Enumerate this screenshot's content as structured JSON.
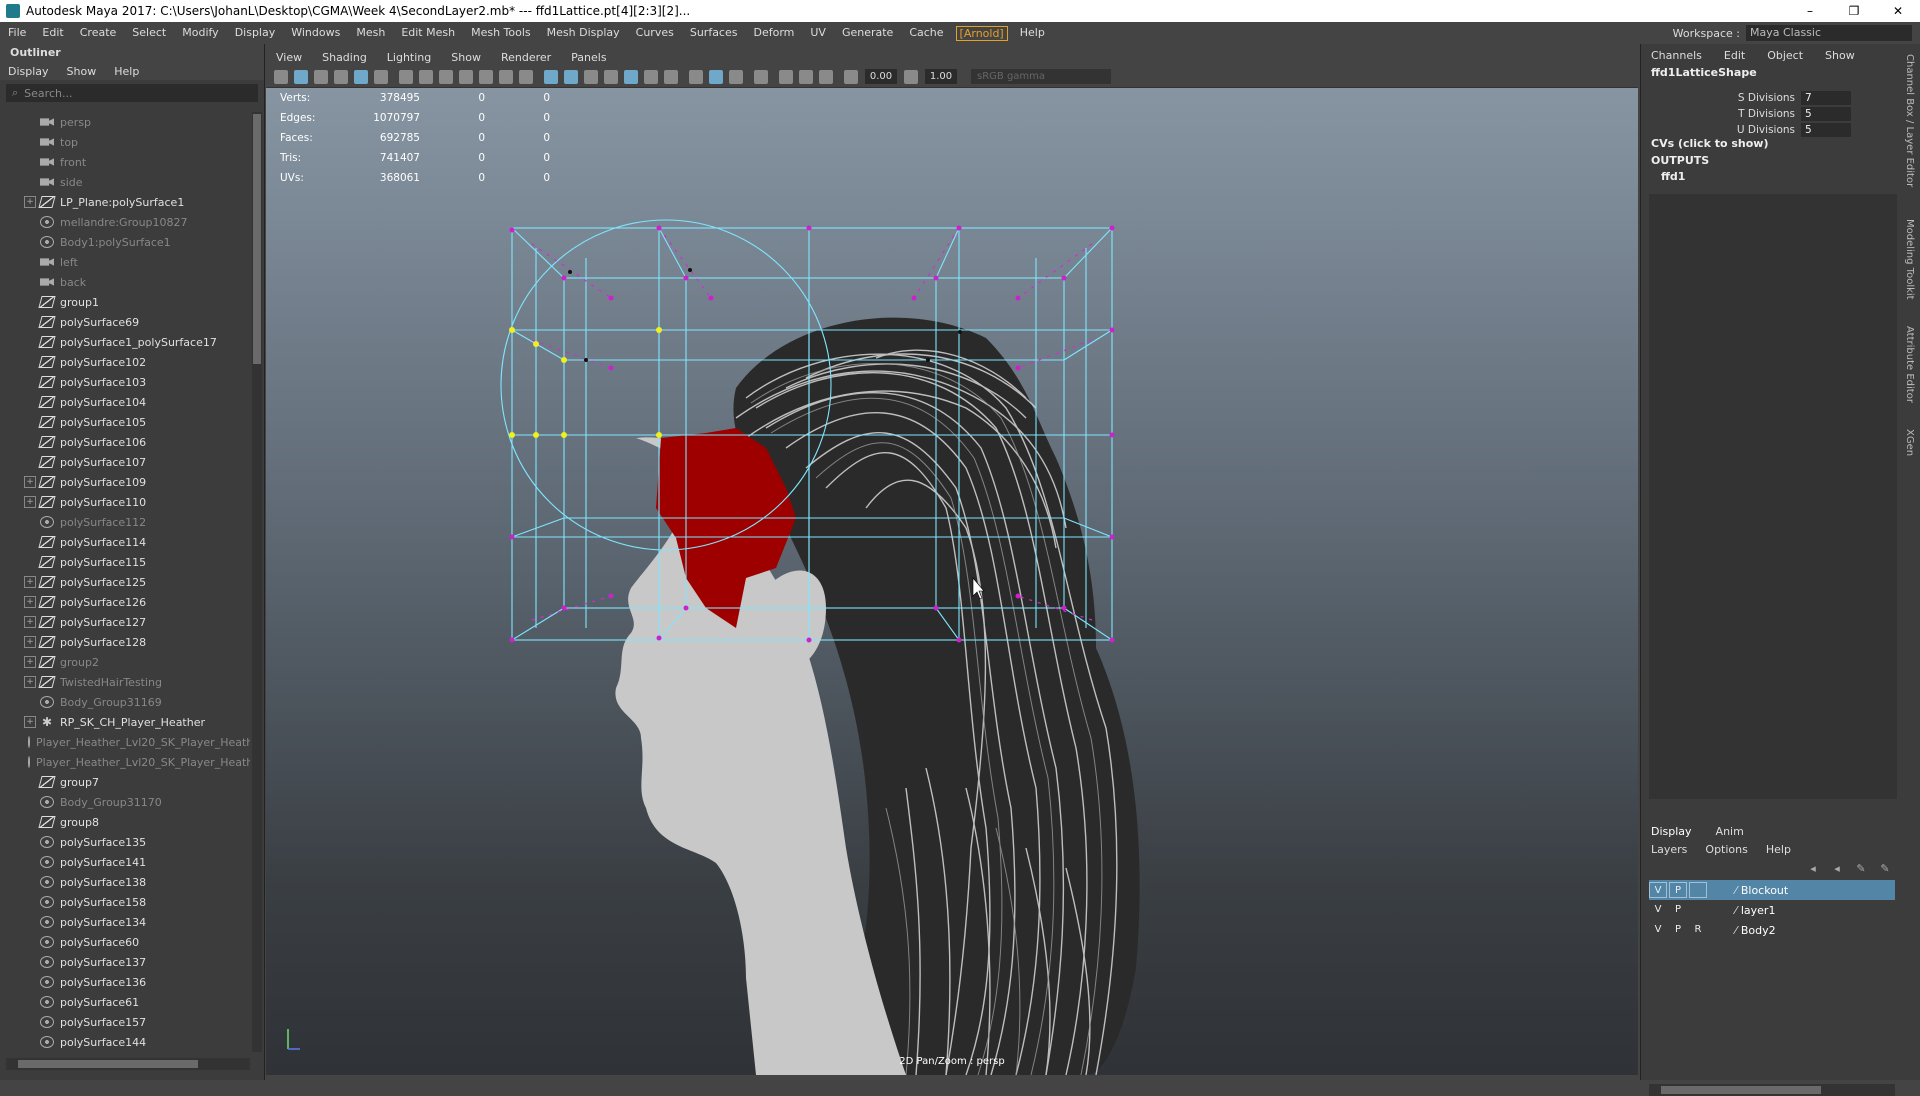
{
  "window": {
    "title": "Autodesk Maya 2017: C:\\Users\\JohanL\\Desktop\\CGMA\\Week 4\\SecondLayer2.mb*  ---  ffd1Lattice.pt[4][2:3][2]...",
    "minimize": "–",
    "maximize": "❐",
    "close": "✕"
  },
  "menubar": {
    "items": [
      "File",
      "Edit",
      "Create",
      "Select",
      "Modify",
      "Display",
      "Windows",
      "Mesh",
      "Edit Mesh",
      "Mesh Tools",
      "Mesh Display",
      "Curves",
      "Surfaces",
      "Deform",
      "UV",
      "Generate",
      "Cache",
      "[Arnold]",
      "Help"
    ],
    "workspace_label": "Workspace :",
    "workspace_value": "Maya Classic"
  },
  "outliner": {
    "title": "Outliner",
    "menu": [
      "Display",
      "Show",
      "Help"
    ],
    "search_placeholder": "Search...",
    "items": [
      {
        "label": "persp",
        "icon": "cam",
        "dim": true,
        "exp": ""
      },
      {
        "label": "top",
        "icon": "cam",
        "dim": true,
        "exp": ""
      },
      {
        "label": "front",
        "icon": "cam",
        "dim": true,
        "exp": ""
      },
      {
        "label": "side",
        "icon": "cam",
        "dim": true,
        "exp": ""
      },
      {
        "label": "LP_Plane:polySurface1",
        "icon": "mesh",
        "dim": false,
        "exp": "+"
      },
      {
        "label": "mellandre:Group10827",
        "icon": "grp",
        "dim": true,
        "exp": ""
      },
      {
        "label": "Body1:polySurface1",
        "icon": "grp",
        "dim": true,
        "exp": ""
      },
      {
        "label": "left",
        "icon": "cam",
        "dim": true,
        "exp": ""
      },
      {
        "label": "back",
        "icon": "cam",
        "dim": true,
        "exp": ""
      },
      {
        "label": "group1",
        "icon": "mesh",
        "dim": false,
        "exp": ""
      },
      {
        "label": "polySurface69",
        "icon": "mesh",
        "dim": false,
        "exp": ""
      },
      {
        "label": "polySurface1_polySurface17",
        "icon": "mesh",
        "dim": false,
        "exp": ""
      },
      {
        "label": "polySurface102",
        "icon": "mesh",
        "dim": false,
        "exp": ""
      },
      {
        "label": "polySurface103",
        "icon": "mesh",
        "dim": false,
        "exp": ""
      },
      {
        "label": "polySurface104",
        "icon": "mesh",
        "dim": false,
        "exp": ""
      },
      {
        "label": "polySurface105",
        "icon": "mesh",
        "dim": false,
        "exp": ""
      },
      {
        "label": "polySurface106",
        "icon": "mesh",
        "dim": false,
        "exp": ""
      },
      {
        "label": "polySurface107",
        "icon": "mesh",
        "dim": false,
        "exp": ""
      },
      {
        "label": "polySurface109",
        "icon": "mesh",
        "dim": false,
        "exp": "+"
      },
      {
        "label": "polySurface110",
        "icon": "mesh",
        "dim": false,
        "exp": "+"
      },
      {
        "label": "polySurface112",
        "icon": "grp",
        "dim": true,
        "exp": ""
      },
      {
        "label": "polySurface114",
        "icon": "mesh",
        "dim": false,
        "exp": ""
      },
      {
        "label": "polySurface115",
        "icon": "mesh",
        "dim": false,
        "exp": ""
      },
      {
        "label": "polySurface125",
        "icon": "mesh",
        "dim": false,
        "exp": "+"
      },
      {
        "label": "polySurface126",
        "icon": "mesh",
        "dim": false,
        "exp": "+"
      },
      {
        "label": "polySurface127",
        "icon": "mesh",
        "dim": false,
        "exp": "+"
      },
      {
        "label": "polySurface128",
        "icon": "mesh",
        "dim": false,
        "exp": "+"
      },
      {
        "label": "group2",
        "icon": "mesh",
        "dim": true,
        "exp": "+"
      },
      {
        "label": "TwistedHairTesting",
        "icon": "mesh",
        "dim": true,
        "exp": "+"
      },
      {
        "label": "Body_Group31169",
        "icon": "grp",
        "dim": true,
        "exp": ""
      },
      {
        "label": "RP_SK_CH_Player_Heather",
        "icon": "joint",
        "dim": false,
        "exp": "+"
      },
      {
        "label": "Player_Heather_Lvl20_SK_Player_Heath",
        "icon": "grp",
        "dim": true,
        "exp": ""
      },
      {
        "label": "Player_Heather_Lvl20_SK_Player_Heath",
        "icon": "grp",
        "dim": true,
        "exp": ""
      },
      {
        "label": "group7",
        "icon": "mesh",
        "dim": false,
        "exp": ""
      },
      {
        "label": "Body_Group31170",
        "icon": "grp",
        "dim": true,
        "exp": ""
      },
      {
        "label": "group8",
        "icon": "mesh",
        "dim": false,
        "exp": ""
      },
      {
        "label": "polySurface135",
        "icon": "grp",
        "dim": false,
        "exp": ""
      },
      {
        "label": "polySurface141",
        "icon": "grp",
        "dim": false,
        "exp": ""
      },
      {
        "label": "polySurface138",
        "icon": "grp",
        "dim": false,
        "exp": ""
      },
      {
        "label": "polySurface158",
        "icon": "grp",
        "dim": false,
        "exp": ""
      },
      {
        "label": "polySurface134",
        "icon": "grp",
        "dim": false,
        "exp": ""
      },
      {
        "label": "polySurface60",
        "icon": "grp",
        "dim": false,
        "exp": ""
      },
      {
        "label": "polySurface137",
        "icon": "grp",
        "dim": false,
        "exp": ""
      },
      {
        "label": "polySurface136",
        "icon": "grp",
        "dim": false,
        "exp": ""
      },
      {
        "label": "polySurface61",
        "icon": "grp",
        "dim": false,
        "exp": ""
      },
      {
        "label": "polySurface157",
        "icon": "grp",
        "dim": false,
        "exp": ""
      },
      {
        "label": "polySurface144",
        "icon": "grp",
        "dim": false,
        "exp": ""
      }
    ]
  },
  "viewport": {
    "menu": [
      "View",
      "Shading",
      "Lighting",
      "Show",
      "Renderer",
      "Panels"
    ],
    "toolbar": {
      "value1": "0.00",
      "value2": "1.00",
      "colorspace": "sRGB gamma"
    },
    "hud": [
      {
        "label": "Verts:",
        "v1": "378495",
        "v2": "0",
        "v3": "0"
      },
      {
        "label": "Edges:",
        "v1": "1070797",
        "v2": "0",
        "v3": "0"
      },
      {
        "label": "Faces:",
        "v1": "692785",
        "v2": "0",
        "v3": "0"
      },
      {
        "label": "Tris:",
        "v1": "741407",
        "v2": "0",
        "v3": "0"
      },
      {
        "label": "UVs:",
        "v1": "368061",
        "v2": "0",
        "v3": "0"
      }
    ],
    "camera_label": "2D Pan/Zoom : persp"
  },
  "channelbox": {
    "menu": [
      "Channels",
      "Edit",
      "Object",
      "Show"
    ],
    "node": "ffd1LatticeShape",
    "attrs": [
      {
        "name": "S Divisions",
        "value": "7"
      },
      {
        "name": "T Divisions",
        "value": "5"
      },
      {
        "name": "U Divisions",
        "value": "5"
      }
    ],
    "cvs_label": "CVs (click to show)",
    "outputs_label": "OUTPUTS",
    "output_node": "ffd1"
  },
  "layers": {
    "tabs": [
      "Display",
      "Anim"
    ],
    "menu": [
      "Layers",
      "Options",
      "Help"
    ],
    "rows": [
      {
        "v": "V",
        "p": "P",
        "r": "",
        "name": "Blockout",
        "selected": true,
        "color": "#5285a6"
      },
      {
        "v": "V",
        "p": "P",
        "r": "",
        "name": "layer1",
        "selected": false,
        "color": "#3c3c3c"
      },
      {
        "v": "V",
        "p": "P",
        "r": "R",
        "name": "Body2",
        "selected": false,
        "color": "#3c3c3c"
      }
    ]
  },
  "side_tabs": [
    "Channel Box / Layer Editor",
    "Modeling Toolkit",
    "Attribute Editor",
    "XGen"
  ]
}
